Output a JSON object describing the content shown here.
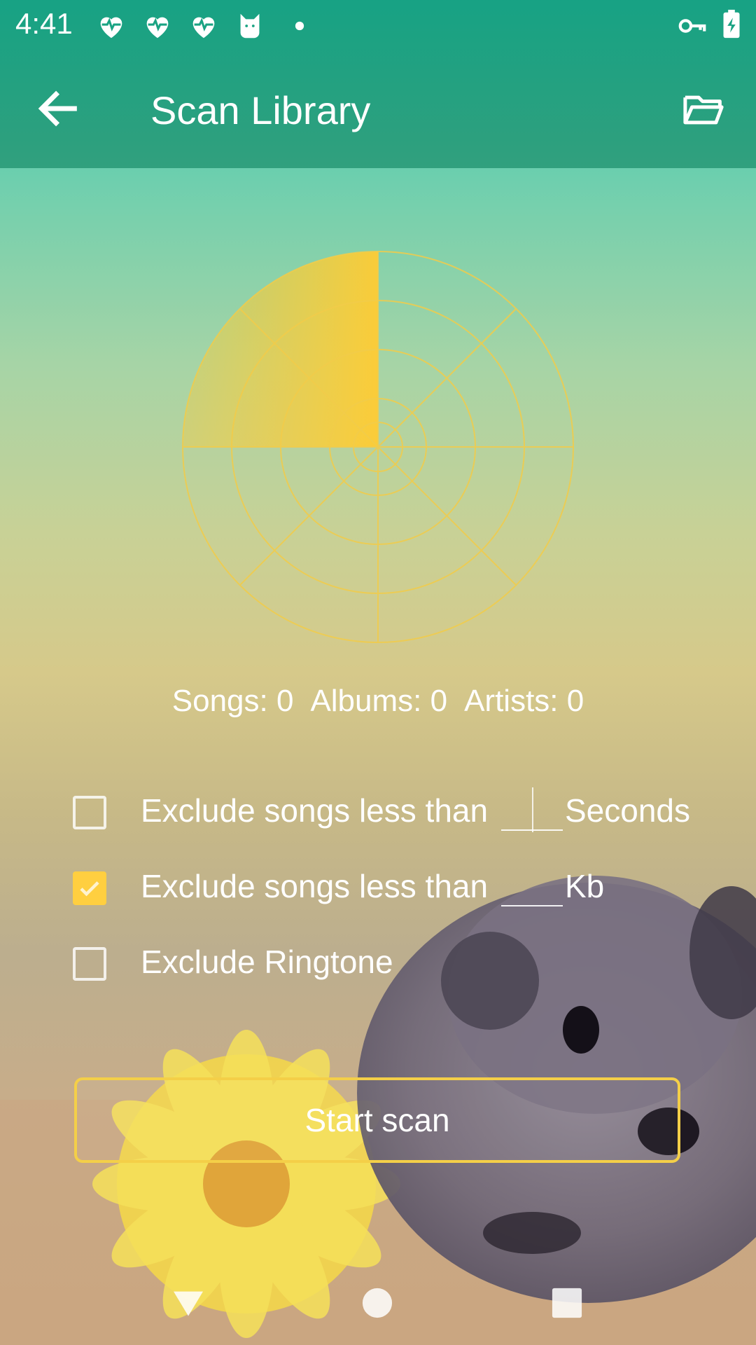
{
  "status_bar": {
    "time": "4:41",
    "icons": [
      "heart-pulse-icon",
      "heart-pulse-icon",
      "heart-pulse-icon",
      "cat-icon",
      "dot-icon",
      "vpn-key-icon",
      "battery-charging-icon"
    ]
  },
  "toolbar": {
    "title": "Scan Library",
    "back_icon": "arrow-back-icon",
    "folder_icon": "folder-open-icon"
  },
  "radar": {
    "progress": 0.25,
    "accent": "#ffcc33"
  },
  "counts": {
    "songs": "Songs: 0",
    "albums": "Albums: 0",
    "artists": "Artists: 0"
  },
  "options": [
    {
      "label": "Exclude songs less than",
      "checked": false,
      "value": "",
      "unit": "Seconds"
    },
    {
      "label": "Exclude songs less than",
      "checked": true,
      "value": "",
      "unit": "Kb"
    },
    {
      "label": "Exclude Ringtone",
      "checked": false
    }
  ],
  "start_button": {
    "label": "Start scan"
  },
  "colors": {
    "accent": "#ffcf40",
    "appbar": "#1aa383"
  },
  "nav_bar": {
    "icons": [
      "back-triangle-icon",
      "home-circle-icon",
      "recents-square-icon"
    ]
  }
}
